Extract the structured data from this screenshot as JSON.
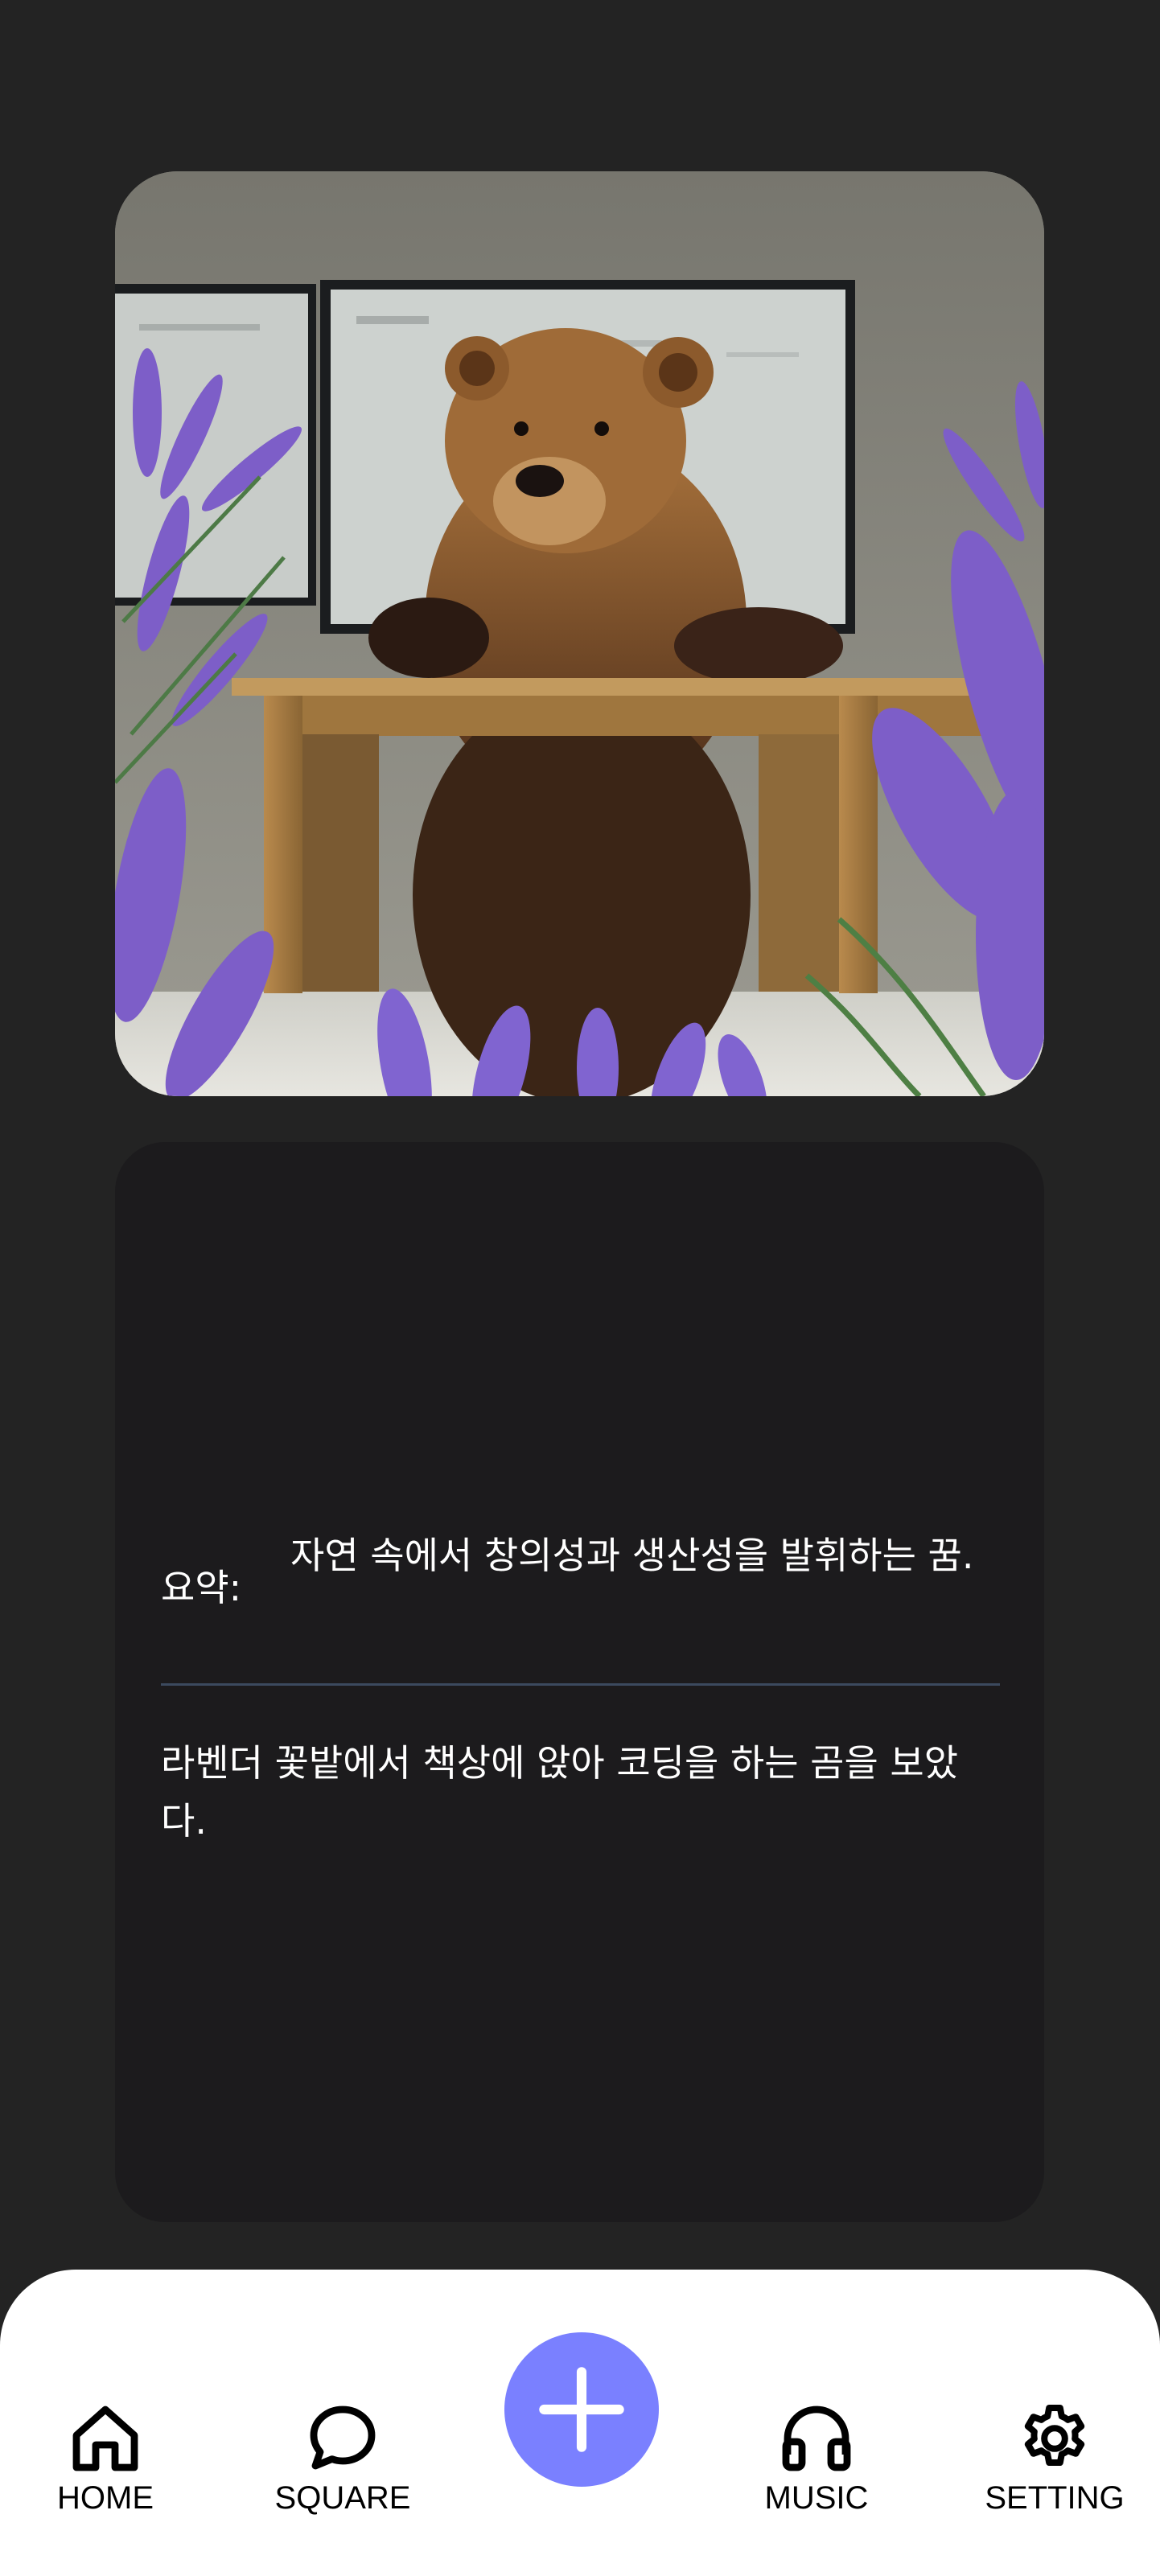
{
  "dream": {
    "image_alt": "bear coding at a desk in a lavender field",
    "summary_label": "요약:",
    "summary": "자연 속에서 창의성과 생산성을 발휘하는 꿈.",
    "content": "라벤더 꽃밭에서 책상에 앉아 코딩을 하는 곰을 보았다."
  },
  "nav": {
    "items": [
      {
        "label": "HOME",
        "icon": "home-icon"
      },
      {
        "label": "SQUARE",
        "icon": "chat-bubble-icon"
      },
      {
        "label": "",
        "icon": "plus-icon"
      },
      {
        "label": "MUSIC",
        "icon": "headphones-icon"
      },
      {
        "label": "SETTING",
        "icon": "gear-icon"
      }
    ]
  },
  "colors": {
    "background": "#232323",
    "card": "#1c1b1d",
    "accent": "#7a80ff",
    "divider": "#3c4a5f"
  }
}
